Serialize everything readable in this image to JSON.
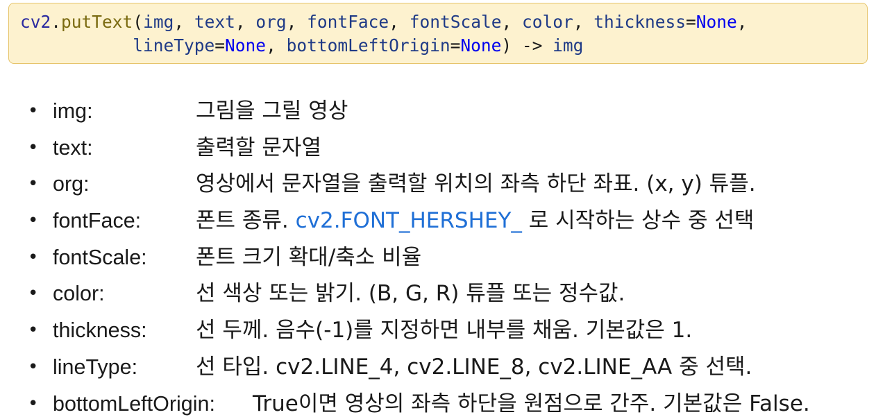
{
  "signature": {
    "module": "cv2",
    "dot": ".",
    "function": "putText",
    "open_paren": "(",
    "line1_params": [
      {
        "name": "img",
        "sep": ", "
      },
      {
        "name": "text",
        "sep": ", "
      },
      {
        "name": "org",
        "sep": ", "
      },
      {
        "name": "fontFace",
        "sep": ", "
      },
      {
        "name": "fontScale",
        "sep": ", "
      },
      {
        "name": "color",
        "sep": ", "
      },
      {
        "name": "thickness",
        "eq": "=",
        "default": "None",
        "sep": ","
      }
    ],
    "line2_indent": "           ",
    "line2_params": [
      {
        "name": "lineType",
        "eq": "=",
        "default": "None",
        "sep": ", "
      },
      {
        "name": "bottomLeftOrigin",
        "eq": "=",
        "default": "None",
        "sep": ""
      }
    ],
    "close": ") -> ",
    "returns": "img"
  },
  "params": [
    {
      "bullet": "•",
      "name": "img:",
      "desc": "그림을 그릴 영상"
    },
    {
      "bullet": "•",
      "name": "text:",
      "desc": "출력할 문자열"
    },
    {
      "bullet": "•",
      "name": "org:",
      "desc": "영상에서 문자열을 출력할 위치의 좌측 하단 좌표. (x, y) 튜플."
    },
    {
      "bullet": "•",
      "name": "fontFace:",
      "desc_before": "폰트 종류. ",
      "desc_link": "cv2.FONT_HERSHEY_",
      "desc_after": " 로 시작하는 상수 중 선택"
    },
    {
      "bullet": "•",
      "name": "fontScale:",
      "desc": "폰트 크기 확대/축소 비율"
    },
    {
      "bullet": "•",
      "name": "color:",
      "desc": "선 색상 또는 밝기. (B, G, R) 튜플 또는 정수값."
    },
    {
      "bullet": "•",
      "name": "thickness:",
      "desc": "선 두께. 음수(-1)를 지정하면 내부를 채움. 기본값은 1."
    },
    {
      "bullet": "•",
      "name": "lineType:",
      "desc": "선 타입. cv2.LINE_4, cv2.LINE_8, cv2.LINE_AA 중 선택."
    },
    {
      "bullet": "•",
      "name": "bottomLeftOrigin:",
      "desc": "True이면 영상의 좌측 하단을 원점으로 간주. 기본값은 False."
    }
  ],
  "colors": {
    "code_background": "#fdf2cf",
    "code_border": "#e6c46a",
    "keyword_none": "#0000ee",
    "link": "#1f6fd6"
  }
}
